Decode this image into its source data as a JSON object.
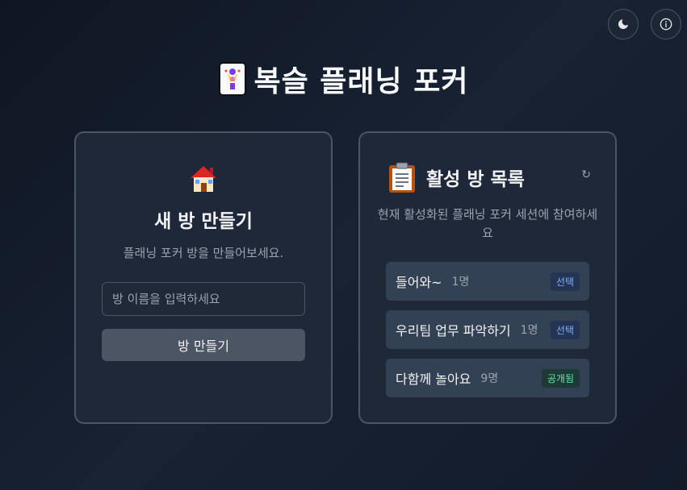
{
  "header": {
    "title": "복슬 플래닝 포커",
    "title_icon": "joker-card-icon"
  },
  "top_buttons": {
    "theme_icon": "moon-icon",
    "info_icon": "info-icon"
  },
  "create_card": {
    "icon": "house-icon",
    "title": "새 방 만들기",
    "description": "플래닝 포커 방을 만들어보세요.",
    "input_placeholder": "방 이름을 입력하세요",
    "input_value": "",
    "button_label": "방 만들기"
  },
  "rooms_card": {
    "icon": "clipboard-icon",
    "title": "활성 방 목록",
    "refresh_label": "↻",
    "description": "현재 활성화된 플래닝 포커 세션에 참여하세요",
    "rooms": [
      {
        "name": "들어와~",
        "count": "1명",
        "badge": "선택",
        "badge_type": "select"
      },
      {
        "name": "우리팀 업무 파악하기",
        "count": "1명",
        "badge": "선택",
        "badge_type": "select"
      },
      {
        "name": "다함께 놀아요",
        "count": "9명",
        "badge": "공개됨",
        "badge_type": "public"
      }
    ]
  },
  "colors": {
    "background": "#131b2b",
    "card": "#1e2838",
    "badge_select": "#7fb1f5",
    "badge_public": "#6ee7a8"
  }
}
